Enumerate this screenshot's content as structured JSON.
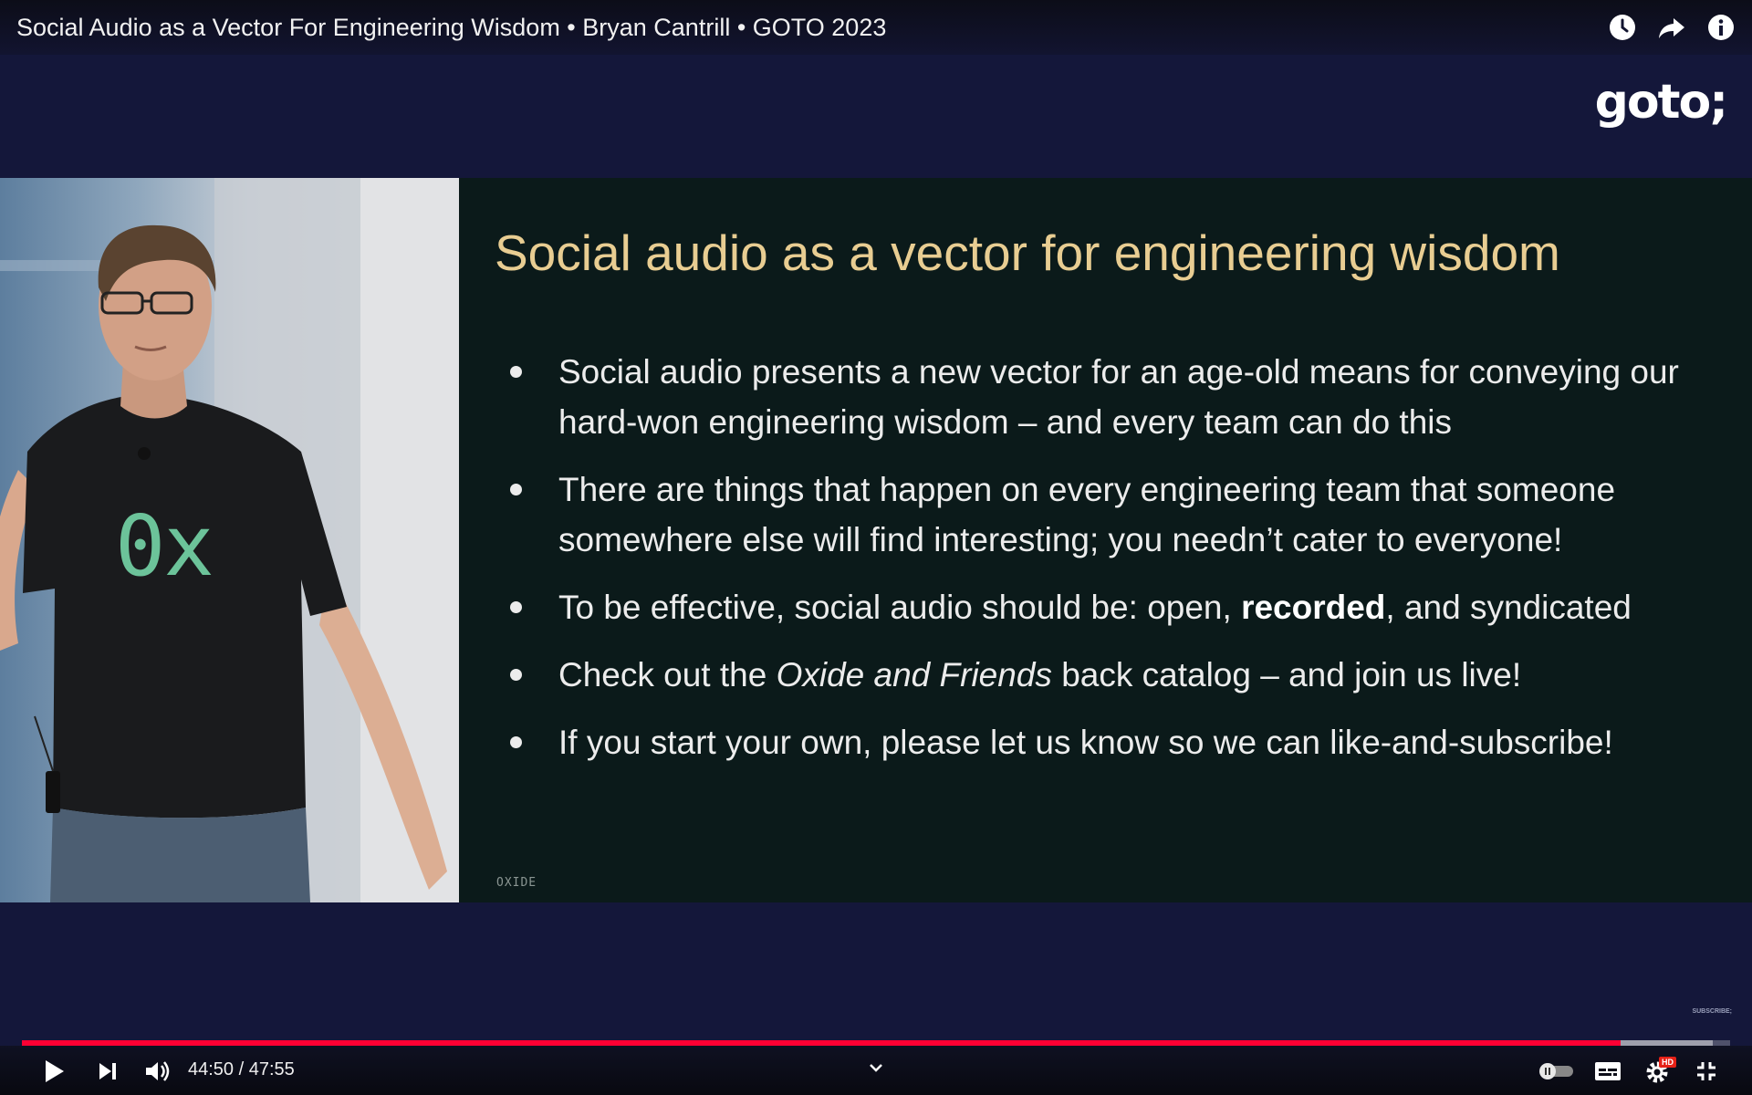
{
  "player": {
    "title": "Social Audio as a Vector For Engineering Wisdom • Bryan Cantrill • GOTO 2023",
    "logo": "goto;",
    "watermark": "SUBSCRIBE;",
    "time": {
      "current": "44:50",
      "separator": " / ",
      "duration": "47:55"
    },
    "progress": {
      "played_fraction": 0.936,
      "buffered_fraction": 0.99
    },
    "colors": {
      "progress_played": "#ff0033",
      "slide_title": "#e8cd92",
      "shirt_logo": "#6cc39a"
    },
    "top_icons": [
      "watch-later-icon",
      "share-icon",
      "info-icon"
    ],
    "control_icons": [
      "play-icon",
      "next-icon",
      "volume-icon",
      "chevron-down-icon",
      "autoplay-toggle-icon",
      "subtitles-icon",
      "settings-hd-icon",
      "exit-fullscreen-icon"
    ],
    "hd_badge": "HD"
  },
  "speaker": {
    "shirt_text": "0x"
  },
  "slide": {
    "title": "Social audio as a vector for engineering wisdom",
    "footer": "OXIDE",
    "bullets": [
      {
        "text": "Social audio presents a new vector for an age-old means for conveying our hard-won engineering wisdom – and every team can do this"
      },
      {
        "text": "There are things that happen on every engineering team that someone somewhere else will find interesting; you needn’t cater to everyone!"
      },
      {
        "before": "To be effective, social audio should be: open, ",
        "bold": "recorded",
        "after": ", and syndicated"
      },
      {
        "before": "Check out the ",
        "italic": "Oxide and Friends",
        "after": " back catalog – and join us live!"
      },
      {
        "text": "If you start your own, please let us know so we can like-and-subscribe!"
      }
    ]
  }
}
